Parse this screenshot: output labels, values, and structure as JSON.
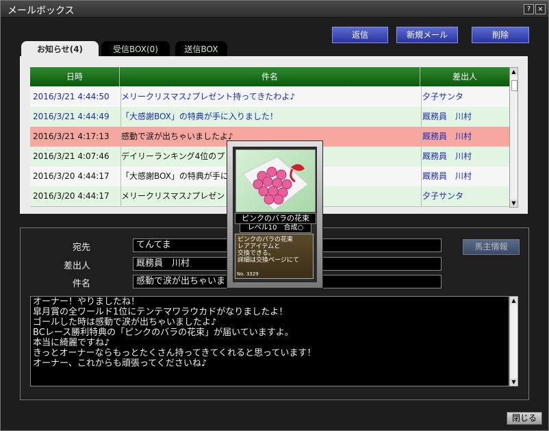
{
  "window": {
    "title": "メールボックス",
    "help": "?",
    "close": "×"
  },
  "toolbar": {
    "reply": "返信",
    "new_mail": "新規メール",
    "delete": "削除"
  },
  "tabs": [
    {
      "label": "お知らせ(4)"
    },
    {
      "label": "受信BOX(0)"
    },
    {
      "label": "送信BOX"
    }
  ],
  "table": {
    "headers": {
      "date": "日時",
      "subject": "件名",
      "sender": "差出人"
    },
    "rows": [
      {
        "date": "2016/3/21 4:44:50",
        "subject": "メリークリスマス♪プレゼント持ってきたわよ♪",
        "sender": "夕子サンタ"
      },
      {
        "date": "2016/3/21 4:44:49",
        "subject": "「大感謝BOX」の特典が手に入りました！",
        "sender": "厩務員　川村"
      },
      {
        "date": "2016/3/21 4:17:13",
        "subject": "感動で涙が出ちゃいましたよ♪",
        "sender": "厩務員　川村"
      },
      {
        "date": "2016/3/21 4:07:46",
        "subject": "デイリーランキング4位のプレゼ",
        "sender": "厩務員　川村"
      },
      {
        "date": "2016/3/20 4:44:17",
        "subject": "「大感謝BOX」の特典が手に入",
        "sender": "厩務員　川村"
      },
      {
        "date": "2016/3/20 4:44:17",
        "subject": "メリークリスマス♪プレゼント持",
        "sender": "夕子サンタ"
      }
    ]
  },
  "detail": {
    "to_label": "宛先",
    "to_value": "てんてま",
    "from_label": "差出人",
    "from_value": "厩務員　川村",
    "subject_label": "件名",
    "subject_value": "感動で涙が出ちゃいま",
    "owner_info": "馬主情報",
    "body": "オーナー！やりましたね！\n皐月賞の全ワールド1位にテンテマワラウカドがなりましたよ！\nゴールした時は感動で涙が出ちゃいましたよ♪\nBCレース勝利特典の「ピンクのバラの花束」が届いていますよ。\n本当に綺麗ですね♪\nきっとオーナーならもっとたくさん持ってきてくれると思っています！\nオーナー、これからも頑張ってくださいね♪"
  },
  "card": {
    "name": "ピンクのバラの花束",
    "level": "レベル10　合成○",
    "description": "ピンクのバラの花束\nレアアイテムと\n交換できる。\n詳細は交換ページにて",
    "number": "No. 3329"
  },
  "footer": {
    "close": "閉じる"
  },
  "colors": {
    "row_green": "#e2f5e2",
    "row_white": "#f6f6f6",
    "row_selected": "#f6a8a0",
    "link_blue": "#1a2ab0",
    "header_green": "#0a5a0a"
  }
}
